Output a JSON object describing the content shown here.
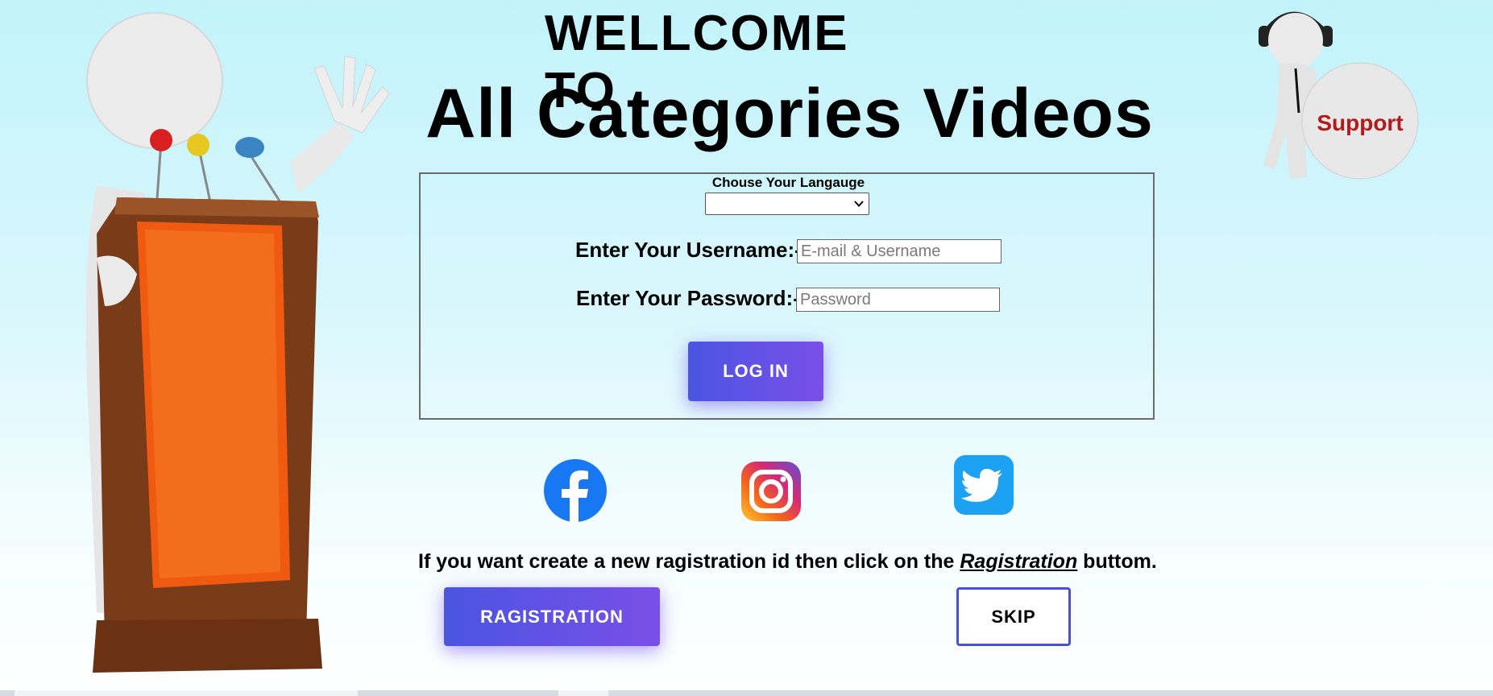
{
  "header": {
    "welcome": "WELLCOME TO",
    "site_title": "All Categories Videos"
  },
  "support_badge": {
    "label": "Support"
  },
  "login_form": {
    "language_label": "Chouse Your Langauge",
    "language_value": "",
    "username_label": "Enter Your Username:-",
    "username_placeholder": "E-mail & Username",
    "username_value": "",
    "password_label": "Enter Your Password:-",
    "password_placeholder": "Password",
    "password_value": "",
    "login_label": "LOG IN"
  },
  "social": [
    {
      "name": "facebook-icon",
      "color": "#1877f2"
    },
    {
      "name": "instagram-icon",
      "color": "#e1306c"
    },
    {
      "name": "twitter-icon",
      "color": "#1da1f2"
    }
  ],
  "registration": {
    "text_before": "If you want create a new ragistration id then click on the ",
    "text_link": "Ragistration",
    "text_after": " buttom.",
    "button_label": "RAGISTRATION",
    "skip_label": "SKIP"
  },
  "colors": {
    "accent_start": "#4a55e0",
    "accent_end": "#7a4fe8",
    "background_top": "#c2f3fb"
  }
}
